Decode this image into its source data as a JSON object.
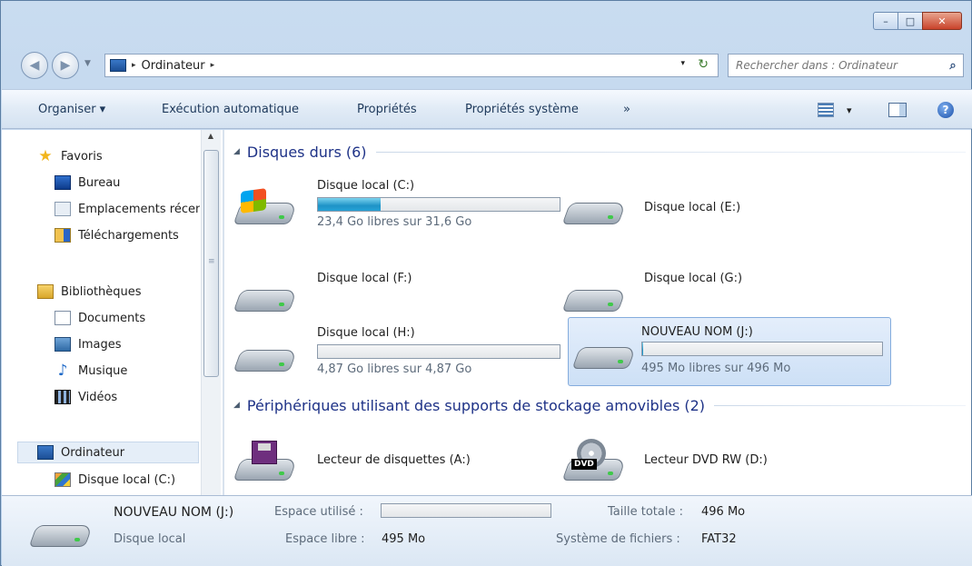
{
  "window": {
    "caption_min": "–",
    "caption_max": "□",
    "caption_close": "✕"
  },
  "address": {
    "sep": "▸",
    "location": "Ordinateur",
    "trail": "▸",
    "dropdown": "▾",
    "refresh": "↻"
  },
  "search": {
    "placeholder": "Rechercher dans : Ordinateur"
  },
  "toolbar": {
    "organize": "Organiser ▾",
    "autorun": "Exécution automatique",
    "properties": "Propriétés",
    "system_properties": "Propriétés système",
    "more": "»",
    "views_drop": "▾"
  },
  "nav": {
    "favorites": "Favoris",
    "desktop": "Bureau",
    "recent_places": "Emplacements récents",
    "downloads": "Téléchargements",
    "libraries": "Bibliothèques",
    "documents": "Documents",
    "pictures": "Images",
    "music": "Musique",
    "videos": "Vidéos",
    "computer": "Ordinateur",
    "drive_c": "Disque local (C:)"
  },
  "groups": {
    "hard_disks": "Disques durs (6)",
    "removable": "Périphériques utilisant des supports de stockage amovibles (2)"
  },
  "drives": {
    "c": {
      "name": "Disque local (C:)",
      "free_text": "23,4 Go libres sur 31,6 Go",
      "used_fraction": 0.26
    },
    "e": {
      "name": "Disque local (E:)"
    },
    "f": {
      "name": "Disque local (F:)"
    },
    "g": {
      "name": "Disque local (G:)"
    },
    "h": {
      "name": "Disque local (H:)",
      "free_text": "4,87 Go libres sur 4,87 Go",
      "used_fraction": 0.0
    },
    "j": {
      "name": "NOUVEAU NOM (J:)",
      "free_text": "495 Mo libres sur 496 Mo",
      "used_fraction": 0.002
    },
    "a": {
      "name": "Lecteur de disquettes (A:)"
    },
    "d": {
      "name": "Lecteur DVD RW (D:)",
      "badge": "DVD"
    }
  },
  "details": {
    "name": "NOUVEAU NOM (J:)",
    "type": "Disque local",
    "used_label": "Espace utilisé :",
    "free_label": "Espace libre :",
    "free_value": "495 Mo",
    "total_label": "Taille totale :",
    "total_value": "496 Mo",
    "fs_label": "Système de fichiers :",
    "fs_value": "FAT32"
  }
}
